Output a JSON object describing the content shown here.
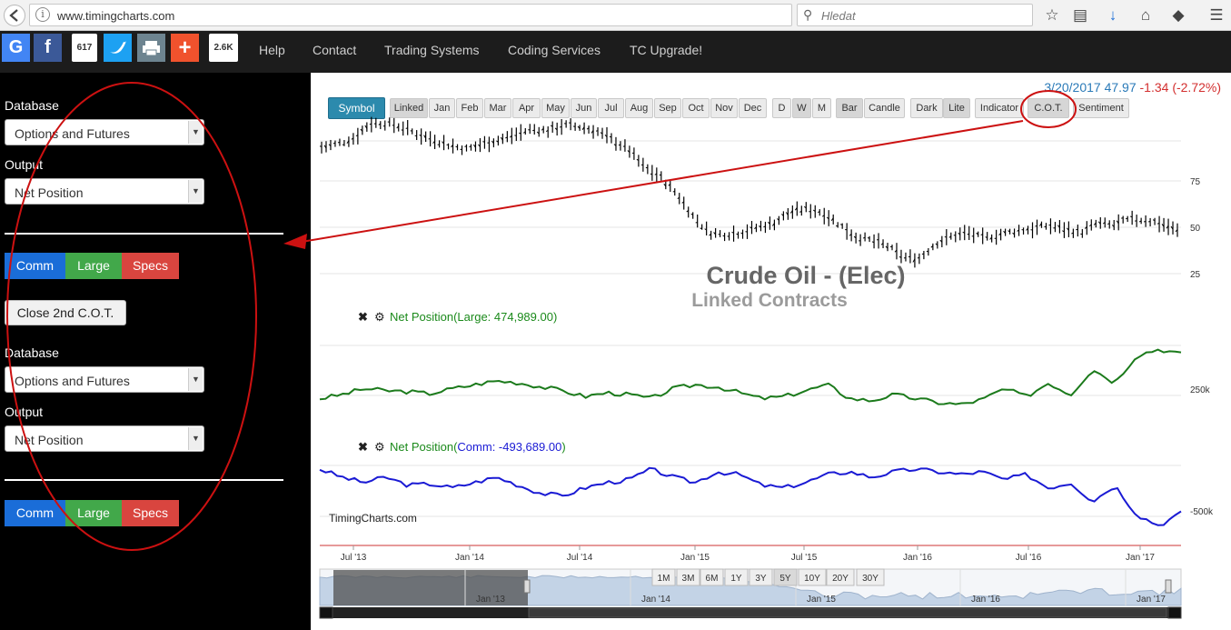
{
  "browser": {
    "url": "www.timingcharts.com",
    "search_placeholder": "Hledat",
    "info_icon": "info-icon",
    "reload_icon": "reload-icon"
  },
  "nav": {
    "share_counts": [
      "617",
      "2.6K"
    ],
    "links": [
      "Help",
      "Contact",
      "Trading Systems",
      "Coding Services",
      "TC Upgrade!"
    ]
  },
  "sidebar": {
    "panel1": {
      "database_label": "Database",
      "database_value": "Options and Futures",
      "output_label": "Output",
      "output_value": "Net Position"
    },
    "buttons1": [
      "Comm",
      "Large",
      "Specs"
    ],
    "close_label": "Close 2nd C.O.T.",
    "panel2": {
      "database_label": "Database",
      "database_value": "Options and Futures",
      "output_label": "Output",
      "output_value": "Net Position"
    },
    "buttons2": [
      "Comm",
      "Large",
      "Specs"
    ]
  },
  "quote": {
    "date": "3/20/2017",
    "price": "47.97",
    "change": "-1.34 (-2.72%)"
  },
  "toolbar": {
    "symbol": "Symbol",
    "months": [
      "Linked",
      "Jan",
      "Feb",
      "Mar",
      "Apr",
      "May",
      "Jun",
      "Jul",
      "Aug",
      "Sep",
      "Oct",
      "Nov",
      "Dec"
    ],
    "periods": [
      "D",
      "W",
      "M"
    ],
    "styles": [
      "Bar",
      "Candle"
    ],
    "themes": [
      "Dark",
      "Lite"
    ],
    "tools": [
      "Indicator",
      "C.O.T.",
      "Sentiment"
    ]
  },
  "ranges": [
    "1M",
    "3M",
    "6M",
    "1Y",
    "3Y",
    "5Y",
    "10Y",
    "20Y",
    "30Y"
  ],
  "colors": {
    "accent": "#2c8aad",
    "large": "#1b7a1b",
    "comm": "#1a1ad4",
    "price": "#000000",
    "annotation": "#cc1111"
  },
  "chart_data": [
    {
      "type": "ohlc-bar",
      "title": "Crude Oil - (Elec)",
      "subtitle": "Linked Contracts",
      "x_ticks": [
        "Jul '13",
        "Jan '14",
        "Jul '14",
        "Jan '15",
        "Jul '15",
        "Jan '16",
        "Jul '16",
        "Jan '17"
      ],
      "y_ticks": [
        75,
        50,
        25
      ],
      "series": [
        {
          "values": [
            93,
            95,
            98,
            106,
            106,
            104,
            100,
            97,
            94,
            92,
            95,
            97,
            100,
            103,
            102,
            105,
            104,
            102,
            97,
            92,
            82,
            77,
            68,
            56,
            47,
            46,
            47,
            50,
            52,
            58,
            60,
            58,
            52,
            45,
            43,
            40,
            34,
            33,
            41,
            45,
            47,
            44,
            46,
            48,
            49,
            51,
            49,
            47,
            52,
            51,
            54,
            54,
            52,
            48
          ]
        }
      ]
    },
    {
      "type": "line",
      "title": "Net Position(Large: 474,989.00)",
      "y_ticks": [
        "250k"
      ],
      "series": [
        {
          "name": "Large",
          "values": [
            250,
            270,
            300,
            290,
            285,
            275,
            300,
            320,
            340,
            330,
            310,
            290,
            260,
            280,
            270,
            250,
            300,
            320,
            310,
            280,
            250,
            260,
            290,
            320,
            250,
            240,
            270,
            250,
            230,
            220,
            245,
            300,
            260,
            330,
            270,
            400,
            330,
            470,
            500,
            475
          ]
        }
      ]
    },
    {
      "type": "line",
      "title": "Net Position(Comm: -493,689.00)",
      "y_ticks": [
        "-500k"
      ],
      "series": [
        {
          "name": "Comm",
          "values": [
            -330,
            -360,
            -380,
            -360,
            -390,
            -385,
            -400,
            -380,
            -360,
            -390,
            -420,
            -430,
            -400,
            -380,
            -370,
            -330,
            -360,
            -380,
            -340,
            -350,
            -390,
            -400,
            -380,
            -350,
            -340,
            -360,
            -340,
            -330,
            -340,
            -350,
            -340,
            -370,
            -350,
            -400,
            -380,
            -450,
            -390,
            -500,
            -540,
            -494
          ]
        }
      ]
    }
  ],
  "watermark": "TimingCharts.com",
  "navigator": {
    "labels": [
      "Jan '13",
      "Jan '14",
      "Jan '15",
      "Jan '16",
      "Jan '17"
    ]
  }
}
